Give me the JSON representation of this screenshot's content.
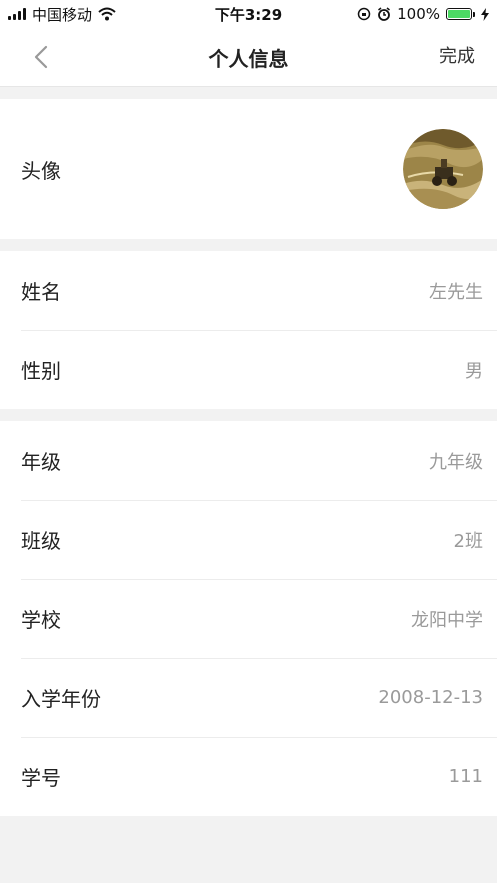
{
  "status_bar": {
    "carrier": "中国移动",
    "time": "下午3:29",
    "battery_percent": "100%",
    "battery_level": 1.0,
    "battery_color": "#4cd964"
  },
  "nav": {
    "title": "个人信息",
    "done_label": "完成",
    "back_icon": "chevron-left-icon"
  },
  "profile": {
    "avatar_label": "头像",
    "name": {
      "label": "姓名",
      "value": "左先生"
    },
    "gender": {
      "label": "性别",
      "value": "男"
    },
    "grade": {
      "label": "年级",
      "value": "九年级"
    },
    "class": {
      "label": "班级",
      "value": "2班"
    },
    "school": {
      "label": "学校",
      "value": "龙阳中学"
    },
    "enroll_year": {
      "label": "入学年份",
      "value": "2008-12-13"
    },
    "student_id": {
      "label": "学号",
      "value": "111"
    }
  }
}
